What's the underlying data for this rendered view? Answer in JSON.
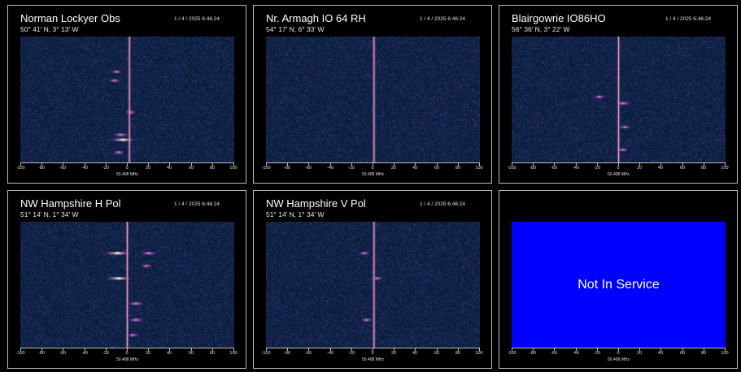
{
  "x_ticks": [
    "-100",
    "-80",
    "-60",
    "-40",
    "-20",
    "0",
    "20",
    "40",
    "60",
    "80",
    "100"
  ],
  "axis_label": "50.408 MHz",
  "panels": [
    {
      "id": "norman-lockyer",
      "title": "Norman Lockyer Obs",
      "timestamp": "1 / 4 / 2025  6:46:24",
      "coords": "50° 41' N, 3° 13' W",
      "status": "active",
      "carrier_offset_hz": 2,
      "traces": [
        {
          "offset_hz": -4,
          "time_frac": 0.82,
          "strength": "strong"
        },
        {
          "offset_hz": -6,
          "time_frac": 0.78,
          "strength": "medium"
        },
        {
          "offset_hz": -12,
          "time_frac": 0.35,
          "strength": "weak"
        },
        {
          "offset_hz": -10,
          "time_frac": 0.28,
          "strength": "weak"
        },
        {
          "offset_hz": 3,
          "time_frac": 0.6,
          "strength": "weak"
        },
        {
          "offset_hz": -8,
          "time_frac": 0.92,
          "strength": "weak"
        }
      ]
    },
    {
      "id": "nr-armagh",
      "title": "Nr. Armagh  IO 64 RH",
      "timestamp": "1 / 4 / 2025  6:46:24",
      "coords": "54° 17' N, 6° 33' W",
      "status": "active",
      "carrier_offset_hz": 1,
      "traces": []
    },
    {
      "id": "blairgowrie",
      "title": "Blairgowrie IO86HO",
      "timestamp": "1 / 4 / 2025  6:46:24",
      "coords": "56° 36' N, 3° 22' W",
      "status": "active",
      "carrier_offset_hz": 0,
      "traces": [
        {
          "offset_hz": -18,
          "time_frac": 0.48,
          "strength": "weak"
        },
        {
          "offset_hz": 4,
          "time_frac": 0.53,
          "strength": "medium"
        },
        {
          "offset_hz": 6,
          "time_frac": 0.72,
          "strength": "weak"
        },
        {
          "offset_hz": 4,
          "time_frac": 0.9,
          "strength": "weak"
        }
      ]
    },
    {
      "id": "nw-hampshire-h",
      "title": "NW Hampshire H Pol",
      "timestamp": "1 / 4 / 2025  6:46:24",
      "coords": "51° 14' N, 1° 34' W",
      "status": "active",
      "carrier_offset_hz": 0,
      "traces": [
        {
          "offset_hz": -9,
          "time_frac": 0.25,
          "strength": "strong"
        },
        {
          "offset_hz": -8,
          "time_frac": 0.45,
          "strength": "strong"
        },
        {
          "offset_hz": 20,
          "time_frac": 0.25,
          "strength": "medium"
        },
        {
          "offset_hz": 18,
          "time_frac": 0.35,
          "strength": "weak"
        },
        {
          "offset_hz": 8,
          "time_frac": 0.65,
          "strength": "medium"
        },
        {
          "offset_hz": 8,
          "time_frac": 0.78,
          "strength": "medium"
        },
        {
          "offset_hz": 5,
          "time_frac": 0.9,
          "strength": "weak"
        }
      ]
    },
    {
      "id": "nw-hampshire-v",
      "title": "NW Hampshire V Pol",
      "timestamp": "1 / 4 / 2025  6:46:24",
      "coords": "51° 14' N, 1° 34' W",
      "status": "active",
      "carrier_offset_hz": 1,
      "traces": [
        {
          "offset_hz": -8,
          "time_frac": 0.25,
          "strength": "weak"
        },
        {
          "offset_hz": 4,
          "time_frac": 0.45,
          "strength": "weak"
        },
        {
          "offset_hz": -6,
          "time_frac": 0.78,
          "strength": "weak"
        }
      ]
    },
    {
      "id": "not-in-service",
      "title": "",
      "timestamp": "",
      "coords": "",
      "status": "Not In Service",
      "carrier_offset_hz": 0,
      "traces": []
    }
  ],
  "colors": {
    "background": "#000000",
    "panel_border": "#bdbdbd",
    "noise_base": "#0c1e3a",
    "signal_hot": "#ffe8a0",
    "signal_mid": "#c040c0",
    "out_of_service": "#0000ff"
  }
}
